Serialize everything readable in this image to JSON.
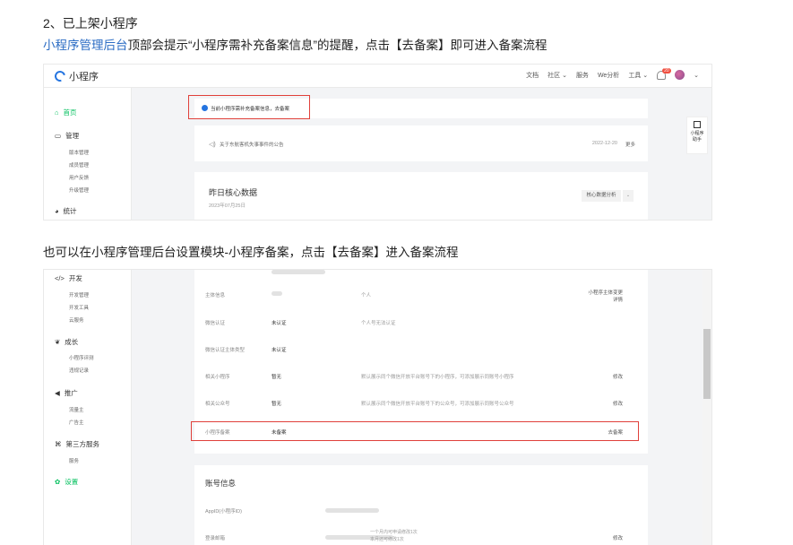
{
  "article": {
    "heading": "2、已上架小程序",
    "intro_link": "小程序管理后台",
    "intro_rest": "顶部会提示“小程序需补充备案信息”的提醒，点击【去备案】即可进入备案流程",
    "intro2": "也可以在小程序管理后台设置模块-小程序备案，点击【去备案】进入备案流程"
  },
  "shot1": {
    "app_name": "小程序",
    "nav": [
      "文档",
      "社区 ⌄",
      "服务",
      "We分析",
      "工具 ⌄"
    ],
    "bell_count": "20",
    "sidebar": {
      "home": "首页",
      "manage": "管理",
      "manage_items": [
        "版本管理",
        "成员管理",
        "用户反馈",
        "升级管理"
      ],
      "stats": "统计"
    },
    "notice_text": "当前小程序需补充备案信息，去备案",
    "announcement": {
      "text": "关于东航客机失事事件的公告",
      "date": "2022-12-20",
      "more": "更多"
    },
    "data_card": {
      "title": "昨日核心数据",
      "date": "2023年07月25日",
      "button": "核心数据分析"
    },
    "float": {
      "label": "小程序\n助手"
    }
  },
  "shot2": {
    "sidebar": {
      "dev": "开发",
      "dev_items": [
        "开发管理",
        "开发工具",
        "云服务"
      ],
      "growth": "成长",
      "growth_items": [
        "小程序评测",
        "违规记录"
      ],
      "promo": "推广",
      "promo_items": [
        "流量主",
        "广告主"
      ],
      "third": "第三方服务",
      "third_items": [
        "服务"
      ],
      "settings": "设置"
    },
    "rows": [
      {
        "label": "主体信息",
        "value": "",
        "desc": "个人",
        "action": "小程序主体变更\n详情"
      },
      {
        "label": "微信认证",
        "value": "未认证",
        "desc": "个人号无法认证",
        "action": ""
      },
      {
        "label": "微信认证主体类型",
        "value": "未认证",
        "desc": "",
        "action": ""
      },
      {
        "label": "相关小程序",
        "value": "暂无",
        "desc": "默认展示同个微信开放平台账号下的小程序，可添加展示同账号小程序",
        "action": "修改"
      },
      {
        "label": "相关公众号",
        "value": "暂无",
        "desc": "默认展示同个微信开放平台账号下的公众号，可添加展示同账号公众号",
        "action": "修改"
      },
      {
        "label": "小程序备案",
        "value": "未备案",
        "desc": "",
        "action": "去备案"
      }
    ],
    "account": {
      "title": "账号信息",
      "appid_label": "AppID(小程序ID)",
      "login_label": "登录邮箱",
      "login_note": "一个月内可申请修改1次\n本月还可修改1次",
      "edit": "修改"
    }
  },
  "colors": {
    "accent_green": "#07c160",
    "highlight_red": "#e0403a",
    "link_blue": "#2b6cc4"
  }
}
